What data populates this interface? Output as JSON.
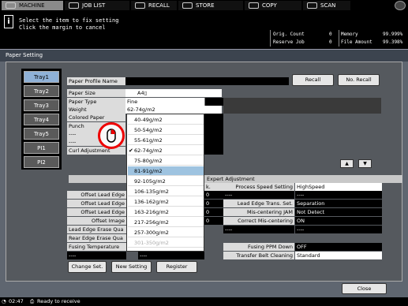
{
  "tabs": [
    {
      "label": "MACHINE",
      "active": true
    },
    {
      "label": "JOB LIST",
      "active": false
    },
    {
      "label": "RECALL",
      "active": false
    },
    {
      "label": "STORE",
      "active": false
    },
    {
      "label": "COPY",
      "active": false
    },
    {
      "label": "SCAN",
      "active": false
    }
  ],
  "message": {
    "line1": "Select the item to fix setting",
    "line2": "Click the margin to cancel"
  },
  "counters": {
    "orig_count_label": "Orig. Count",
    "orig_count_value": "0",
    "memory_label": "Memory",
    "memory_value": "99.999%",
    "reserve_job_label": "Reserve Job",
    "reserve_job_value": "0",
    "file_amount_label": "File Amount",
    "file_amount_value": "99.398%"
  },
  "window_title": "Paper Setting",
  "trays": [
    "Tray1",
    "Tray2",
    "Tray3",
    "Tray4",
    "Tray5",
    "PI1",
    "PI2"
  ],
  "profile": {
    "name_label": "Paper Profile Name",
    "recall_button": "Recall",
    "no_recall_button": "No. Recall",
    "rows": [
      {
        "label": "Paper Size",
        "value": "A4▯"
      },
      {
        "label": "Paper Type",
        "value": "Fine"
      },
      {
        "label": "Weight",
        "value": "62-74g/m2"
      },
      {
        "label": "Colored Paper",
        "value": ""
      },
      {
        "label": "Punch",
        "value": ""
      },
      {
        "label": "----",
        "value": ""
      },
      {
        "label": "----",
        "value": ""
      },
      {
        "label": "Curl Adjustment",
        "value": ""
      }
    ]
  },
  "weight_options": [
    {
      "label": "40-49g/m2",
      "checked": false
    },
    {
      "label": "50-54g/m2",
      "checked": false
    },
    {
      "label": "55-61g/m2",
      "checked": false
    },
    {
      "label": "62-74g/m2",
      "checked": true
    },
    {
      "label": "75-80g/m2",
      "checked": false
    },
    {
      "label": "81-91g/m2",
      "checked": false,
      "highlighted": true
    },
    {
      "label": "92-105g/m2",
      "checked": false
    },
    {
      "label": "106-135g/m2",
      "checked": false
    },
    {
      "label": "136-162g/m2",
      "checked": false
    },
    {
      "label": "163-216g/m2",
      "checked": false
    },
    {
      "label": "217-256g/m2",
      "checked": false
    },
    {
      "label": "257-300g/m2",
      "checked": false
    },
    {
      "label": "301-350g/m2",
      "checked": false,
      "disabled": true
    }
  ],
  "expert": {
    "title": "Expert Adjustment",
    "left_header": "k.",
    "left_rows": [
      {
        "label": "Offset Lead Edge",
        "value": "0"
      },
      {
        "label": "Offset Lead Edge",
        "value": "0"
      },
      {
        "label": "Offset Lead Edge",
        "value": "0"
      },
      {
        "label": "Offset Image",
        "value": "0"
      },
      {
        "label": "Lead Edge Erase Qua",
        "value": ""
      },
      {
        "label": "Rear Edge Erase Qua",
        "value": ""
      },
      {
        "label": "Fusing Temperature",
        "value": ""
      },
      {
        "label": "----",
        "value": "----"
      }
    ],
    "right_rows": [
      {
        "label": "Process Speed Setting",
        "value": "HighSpeed"
      },
      {
        "label": "----",
        "value": "----"
      },
      {
        "label": "Lead Edge Trans. Set.",
        "value": "Separation"
      },
      {
        "label": "Mis-centering JAM",
        "value": "Not Detect"
      },
      {
        "label": "Correct Mis-centering",
        "value": "ON"
      },
      {
        "label": "----",
        "value": "----"
      },
      {
        "label": "Fusing PPM Down",
        "value": "OFF"
      },
      {
        "label": "Transfer Belt Cleaning",
        "value": "Standard"
      }
    ]
  },
  "buttons": {
    "change_set": "Change Set.",
    "new_setting": "New Setting",
    "register": "Register",
    "close": "Close"
  },
  "status": {
    "time": "02:47",
    "text": "Ready to receive"
  }
}
